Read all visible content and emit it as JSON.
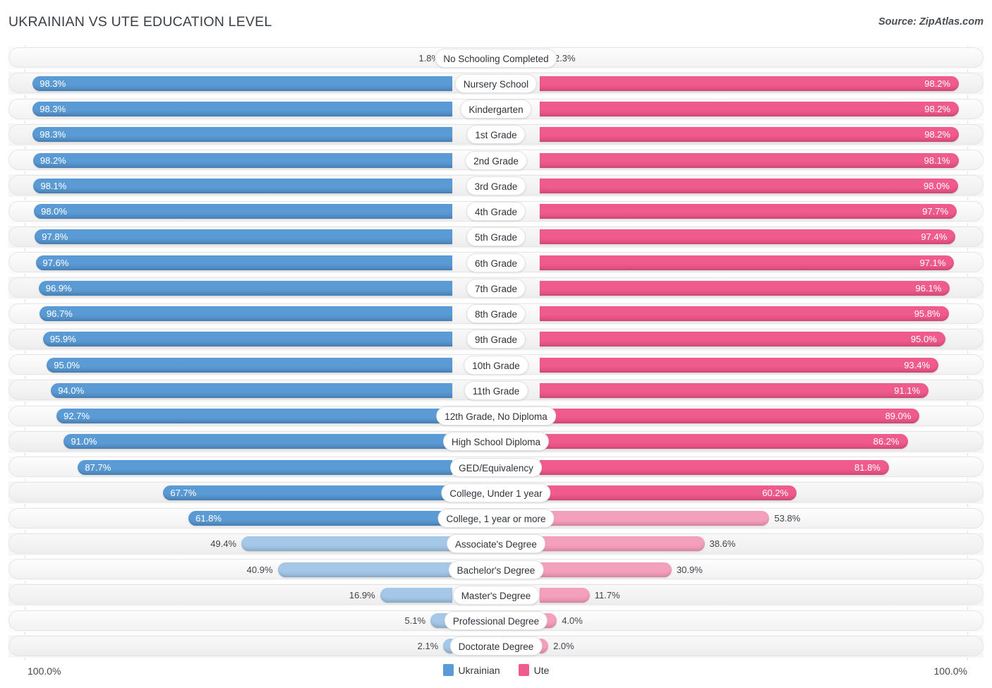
{
  "header": {
    "title": "UKRAINIAN VS UTE EDUCATION LEVEL",
    "source": "Source: ZipAtlas.com"
  },
  "legend": {
    "items": [
      {
        "label": "Ukrainian",
        "color": "#5b9bd5"
      },
      {
        "label": "Ute",
        "color": "#ef5b8c"
      }
    ]
  },
  "axis": {
    "left_end": "100.0%",
    "right_end": "100.0%"
  },
  "colors": {
    "blue_strong": "#5b9bd5",
    "blue_light": "#a6c8e8",
    "pink_strong": "#ef5b8c",
    "pink_light": "#f3a0bd",
    "track": "#f5f5f6",
    "grid": "#e3e3e6"
  },
  "chart_data": {
    "type": "bar",
    "title": "UKRAINIAN VS UTE EDUCATION LEVEL",
    "subtitle": "",
    "xlabel": "",
    "ylabel": "",
    "orientation": "horizontal-diverging",
    "axis_max": 100.0,
    "axis_left_label": "100.0%",
    "axis_right_label": "100.0%",
    "grid": false,
    "legend_position": "bottom-center",
    "categories": [
      "No Schooling Completed",
      "Nursery School",
      "Kindergarten",
      "1st Grade",
      "2nd Grade",
      "3rd Grade",
      "4th Grade",
      "5th Grade",
      "6th Grade",
      "7th Grade",
      "8th Grade",
      "9th Grade",
      "10th Grade",
      "11th Grade",
      "12th Grade, No Diploma",
      "High School Diploma",
      "GED/Equivalency",
      "College, Under 1 year",
      "College, 1 year or more",
      "Associate's Degree",
      "Bachelor's Degree",
      "Master's Degree",
      "Professional Degree",
      "Doctorate Degree"
    ],
    "series": [
      {
        "name": "Ukrainian",
        "color": "#5b9bd5",
        "values": [
          1.8,
          98.3,
          98.3,
          98.3,
          98.2,
          98.1,
          98.0,
          97.8,
          97.6,
          96.9,
          96.7,
          95.9,
          95.0,
          94.0,
          92.7,
          91.0,
          87.7,
          67.7,
          61.8,
          49.4,
          40.9,
          16.9,
          5.1,
          2.1
        ],
        "labels": [
          "1.8%",
          "98.3%",
          "98.3%",
          "98.3%",
          "98.2%",
          "98.1%",
          "98.0%",
          "97.8%",
          "97.6%",
          "96.9%",
          "96.7%",
          "95.9%",
          "95.0%",
          "94.0%",
          "92.7%",
          "91.0%",
          "87.7%",
          "67.7%",
          "61.8%",
          "49.4%",
          "40.9%",
          "16.9%",
          "5.1%",
          "2.1%"
        ]
      },
      {
        "name": "Ute",
        "color": "#ef5b8c",
        "values": [
          2.3,
          98.2,
          98.2,
          98.2,
          98.1,
          98.0,
          97.7,
          97.4,
          97.1,
          96.1,
          95.8,
          95.0,
          93.4,
          91.1,
          89.0,
          86.2,
          81.8,
          60.2,
          53.8,
          38.6,
          30.9,
          11.7,
          4.0,
          2.0
        ],
        "labels": [
          "2.3%",
          "98.2%",
          "98.2%",
          "98.2%",
          "98.1%",
          "98.0%",
          "97.7%",
          "97.4%",
          "97.1%",
          "96.1%",
          "95.8%",
          "95.0%",
          "93.4%",
          "91.1%",
          "89.0%",
          "86.2%",
          "81.8%",
          "60.2%",
          "53.8%",
          "38.6%",
          "30.9%",
          "11.7%",
          "4.0%",
          "2.0%"
        ]
      }
    ]
  }
}
